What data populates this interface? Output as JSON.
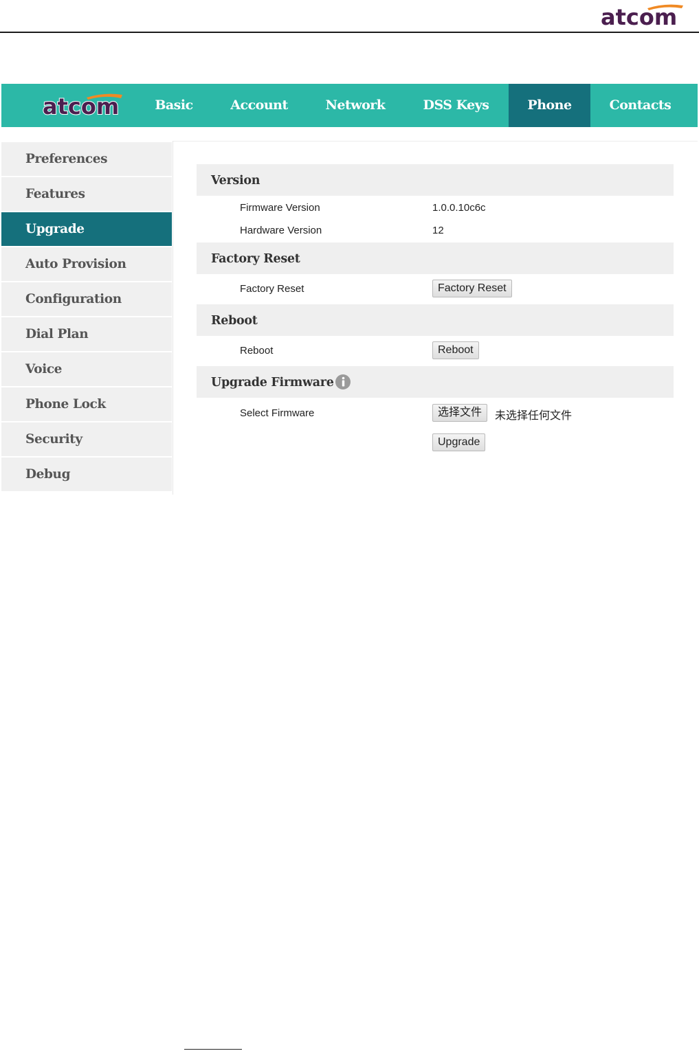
{
  "page_header": {
    "logo_text": "atcom"
  },
  "nav": {
    "logo_text": "atcom",
    "tabs": [
      {
        "label": "Basic"
      },
      {
        "label": "Account"
      },
      {
        "label": "Network"
      },
      {
        "label": "DSS Keys"
      },
      {
        "label": "Phone",
        "active": true
      },
      {
        "label": "Contacts"
      }
    ]
  },
  "sidebar": {
    "items": [
      {
        "label": "Preferences"
      },
      {
        "label": "Features"
      },
      {
        "label": "Upgrade",
        "active": true
      },
      {
        "label": "Auto Provision"
      },
      {
        "label": "Configuration"
      },
      {
        "label": "Dial Plan"
      },
      {
        "label": "Voice"
      },
      {
        "label": "Phone Lock"
      },
      {
        "label": "Security"
      },
      {
        "label": "Debug"
      }
    ]
  },
  "version": {
    "title": "Version",
    "firmware_label": "Firmware Version",
    "firmware_value": "1.0.0.10c6c",
    "hardware_label": "Hardware Version",
    "hardware_value": "12"
  },
  "factory_reset": {
    "title": "Factory Reset",
    "label": "Factory Reset",
    "button": "Factory Reset"
  },
  "reboot": {
    "title": "Reboot",
    "label": "Reboot",
    "button": "Reboot"
  },
  "upgrade_firmware": {
    "title": "Upgrade Firmware",
    "select_label": "Select Firmware",
    "choose_file_button": "选择文件",
    "file_status": "未选择任何文件",
    "upgrade_button": "Upgrade"
  },
  "colors": {
    "nav_bg": "#2cb8a7",
    "active_bg": "#15707c",
    "logo_purple": "#4b1f4f",
    "logo_orange": "#f08a24"
  }
}
